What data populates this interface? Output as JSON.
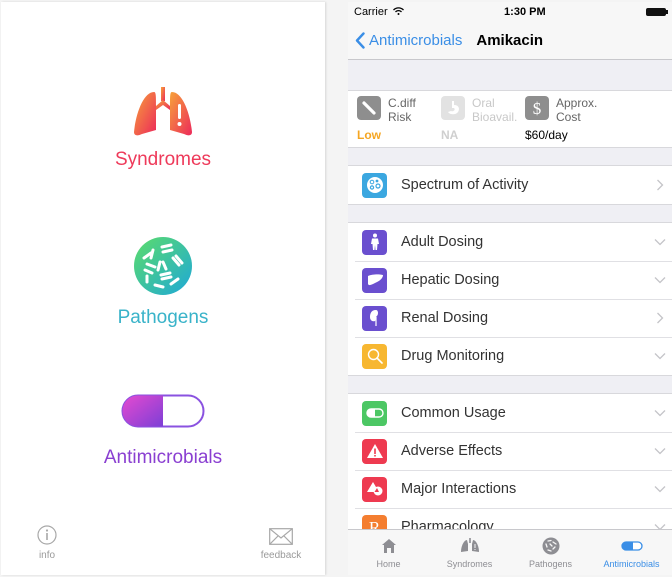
{
  "home": {
    "items": [
      {
        "label": "Syndromes",
        "icon": "lungs-alert-icon",
        "color": "#ee3a5a"
      },
      {
        "label": "Pathogens",
        "icon": "bacteria-icon",
        "color": "#39b3c9"
      },
      {
        "label": "Antimicrobials",
        "icon": "pill-icon",
        "color": "#8a3fd1"
      }
    ],
    "footer": {
      "info_label": "info",
      "feedback_label": "feedback"
    }
  },
  "detail": {
    "status_bar": {
      "carrier": "Carrier",
      "time": "1:30 PM"
    },
    "nav": {
      "back_label": "Antimicrobials",
      "title": "Amikacin"
    },
    "stats": [
      {
        "name_line1": "C.diff",
        "name_line2": "Risk",
        "value": "Low",
        "value_color": "#f5a623",
        "icon": "bandage-icon"
      },
      {
        "name_line1": "Oral",
        "name_line2": "Bioavail.",
        "value": "NA",
        "value_color": "#cfcfcf",
        "icon": "stomach-icon"
      },
      {
        "name_line1": "Approx.",
        "name_line2": "Cost",
        "value": "$60/day",
        "value_color": "#000000",
        "icon": "dollar-icon"
      }
    ],
    "groups": [
      [
        {
          "label": "Spectrum of Activity",
          "icon": "spectrum-icon",
          "color": "#3ba7e0",
          "accessory": "chevron-right"
        }
      ],
      [
        {
          "label": "Adult Dosing",
          "icon": "person-icon",
          "color": "#6a4fcf",
          "accessory": "chevron-down"
        },
        {
          "label": "Hepatic Dosing",
          "icon": "liver-icon",
          "color": "#6a4fcf",
          "accessory": "chevron-down"
        },
        {
          "label": "Renal Dosing",
          "icon": "kidney-icon",
          "color": "#6a4fcf",
          "accessory": "chevron-right"
        },
        {
          "label": "Drug Monitoring",
          "icon": "magnifier-icon",
          "color": "#f7b731",
          "accessory": "chevron-down"
        }
      ],
      [
        {
          "label": "Common Usage",
          "icon": "pill-icon",
          "color": "#4cc764",
          "accessory": "chevron-down"
        },
        {
          "label": "Adverse Effects",
          "icon": "warning-icon",
          "color": "#ee3a50",
          "accessory": "chevron-down"
        },
        {
          "label": "Major Interactions",
          "icon": "shapes-icon",
          "color": "#ee3a50",
          "accessory": "chevron-down"
        },
        {
          "label": "Pharmacology",
          "icon": "rx-icon",
          "color": "#f47e30",
          "accessory": "chevron-down"
        }
      ]
    ],
    "tabs": [
      {
        "label": "Home",
        "icon": "home-icon",
        "active": false
      },
      {
        "label": "Syndromes",
        "icon": "lungs-icon",
        "active": false
      },
      {
        "label": "Pathogens",
        "icon": "bacteria-icon",
        "active": false
      },
      {
        "label": "Antimicrobials",
        "icon": "pill-icon",
        "active": true
      }
    ],
    "accent_color": "#3a8ee6"
  }
}
